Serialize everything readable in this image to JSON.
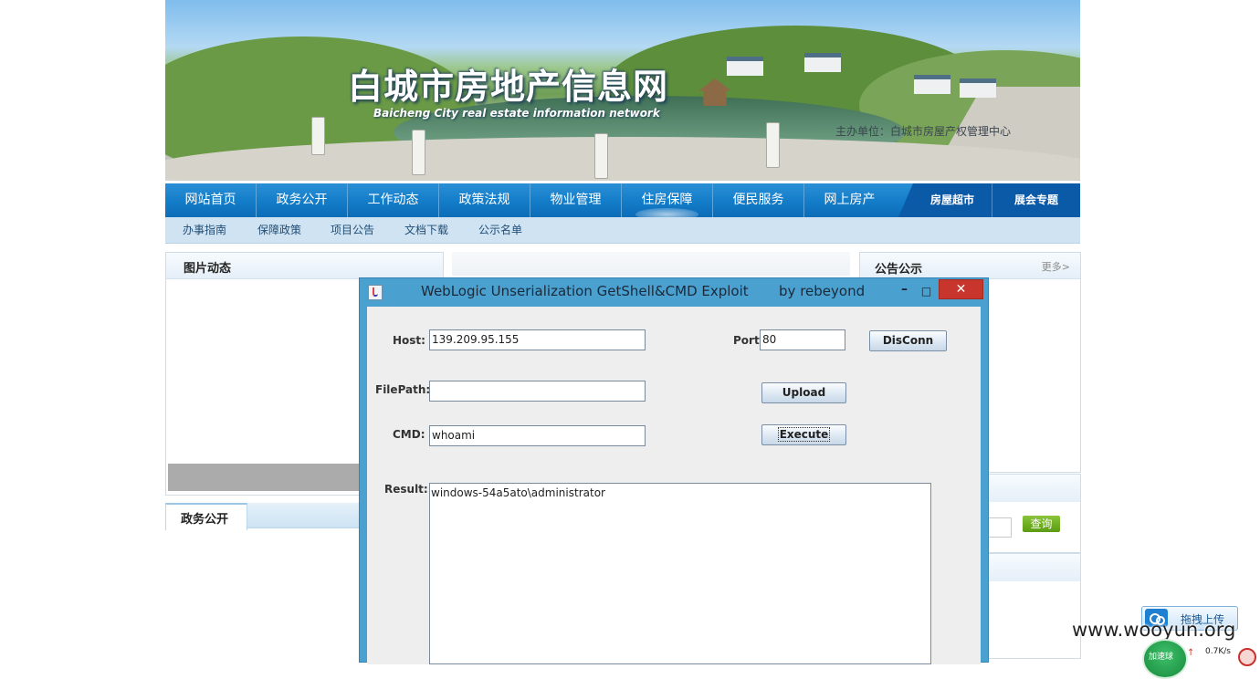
{
  "banner": {
    "title": "白城市房地产信息网",
    "subtitle": "Baicheng City real estate information network",
    "host_org": "主办单位：白城市房屋产权管理中心"
  },
  "nav": {
    "items": [
      {
        "label": "网站首页"
      },
      {
        "label": "政务公开"
      },
      {
        "label": "工作动态"
      },
      {
        "label": "政策法规"
      },
      {
        "label": "物业管理"
      },
      {
        "label": "住房保障"
      },
      {
        "label": "便民服务"
      },
      {
        "label": "网上房产"
      }
    ],
    "right_items": [
      {
        "label": "房屋超市"
      },
      {
        "label": "展会专题"
      }
    ],
    "sub_items": [
      {
        "label": "办事指南"
      },
      {
        "label": "保障政策"
      },
      {
        "label": "项目公告"
      },
      {
        "label": "文档下载"
      },
      {
        "label": "公示名单"
      }
    ]
  },
  "panels": {
    "photo_news_title": "图片动态",
    "notice_title": "公告公示",
    "notice_more": "更多>",
    "gov_tab_label": "政务公开",
    "query_button": "查询"
  },
  "exploit_window": {
    "title": "WebLogic Unserialization GetShell&CMD Exploit       by rebeyond",
    "minimize_glyph": "–",
    "maximize_glyph": "□",
    "close_glyph": "✕",
    "host_label": "Host:",
    "host_value": "139.209.95.155",
    "port_label": "Port:",
    "port_value": "80",
    "disconnect_button": "DisConn",
    "filepath_label": "FilePath:",
    "filepath_value": "",
    "upload_button": "Upload",
    "cmd_label": "CMD:",
    "cmd_value": "whoami",
    "execute_button": "Execute",
    "result_label": "Result:",
    "result_value": "windows-54a5ato\\administrator"
  },
  "overlay": {
    "drag_upload_label": "拖拽上传",
    "watermark": "www.wooyun.org",
    "speed_ball_label": "加速球",
    "upload_speed": "0.7K/s"
  },
  "colors": {
    "nav_blue": "#137cc8",
    "subnav_blue": "#cfe3f2",
    "window_frame": "#4aa0cf",
    "close_red": "#c7352c",
    "query_green": "#5b9b12"
  },
  "icons": {
    "app": "java-cup-icon",
    "cloud": "cloud-upload-icon"
  }
}
